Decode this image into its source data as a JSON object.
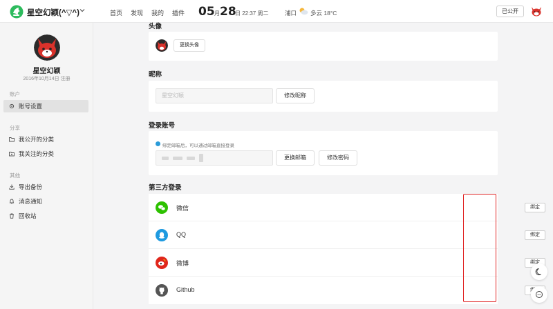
{
  "header": {
    "brand": "星空幻颖(^▽^)",
    "nav": [
      "首页",
      "发现",
      "我的",
      "插件"
    ],
    "date_month": "05",
    "date_month_unit": "月",
    "date_day": "28",
    "date_rest": "日 22:37 周二",
    "city": "浦口",
    "weather": "多云 18°C",
    "public_button": "已公开"
  },
  "sidebar": {
    "name": "星空幻颖",
    "registered": "2016年10月14日 注册",
    "groups": {
      "account": "账户",
      "share": "分享",
      "other": "其他"
    },
    "items": [
      {
        "label": "账号设置",
        "icon": "gear-icon",
        "active": true
      },
      {
        "label": "我公开的分类",
        "icon": "folder-icon"
      },
      {
        "label": "我关注的分类",
        "icon": "folder-star-icon"
      },
      {
        "label": "导出备份",
        "icon": "download-icon"
      },
      {
        "label": "消息通知",
        "icon": "bell-icon"
      },
      {
        "label": "回收站",
        "icon": "trash-icon"
      }
    ]
  },
  "main": {
    "avatar_section": {
      "title": "头像",
      "change_button": "更换头像"
    },
    "nickname_section": {
      "title": "昵称",
      "value": "星空幻颖",
      "change_button": "修改昵称"
    },
    "login_section": {
      "title": "登录账号",
      "hint": "绑定邮箱后，可以通过邮箱直接登录",
      "change_email_button": "更换邮箱",
      "change_password_button": "修改密码"
    },
    "third_party_section": {
      "title": "第三方登录",
      "bind_label": "绑定",
      "providers": [
        {
          "name": "微信",
          "icon": "wechat-icon",
          "color": "#2dc100"
        },
        {
          "name": "QQ",
          "icon": "qq-icon",
          "color": "#1e9ae0"
        },
        {
          "name": "微博",
          "icon": "weibo-icon",
          "color": "#e0261b"
        },
        {
          "name": "Github",
          "icon": "github-icon",
          "color": "#555555"
        }
      ]
    }
  },
  "colors": {
    "highlight": "#e02424",
    "brand_green": "#2dbb5d"
  },
  "floating": [
    "moon-icon",
    "chat-icon"
  ]
}
